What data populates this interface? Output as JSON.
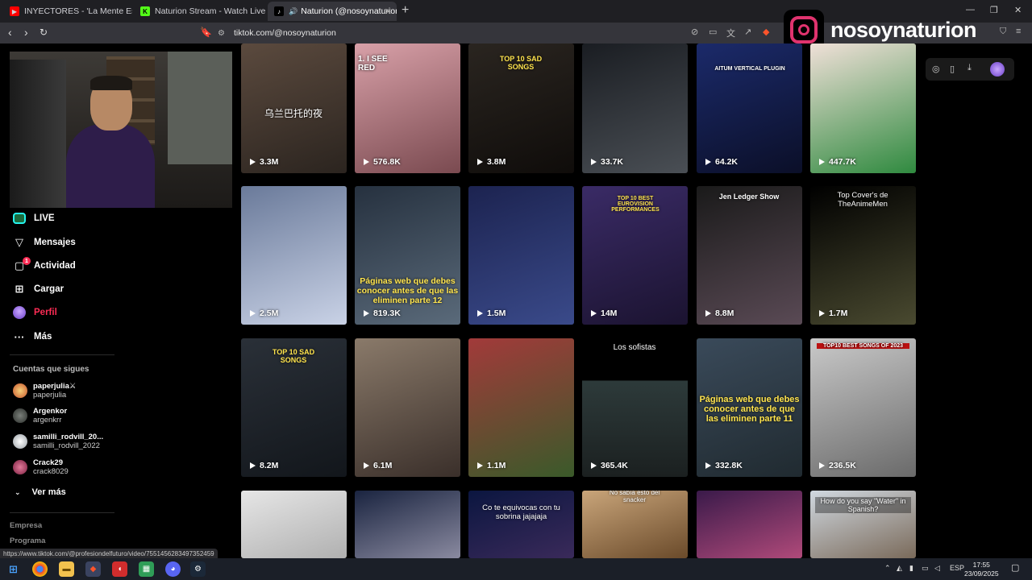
{
  "browser": {
    "tabs": [
      {
        "title": "INYECTORES - 'La Mente Es Un Lugar",
        "favicon": "youtube-icon",
        "color": "#ff0000"
      },
      {
        "title": "Naturion Stream - Watch Live on Kick",
        "favicon": "kick-icon",
        "color": "#53fc18"
      },
      {
        "title": "Naturion (@nosoynaturion) |",
        "favicon": "tiktok-icon",
        "color": "#ffffff",
        "active": true
      }
    ],
    "url": "tiktok.com/@nosoynaturion",
    "status_url": "https://www.tiktok.com/@profesiondelfuturo/video/7551456283497352459"
  },
  "overlay": {
    "instagram_handle": "nosoynaturion",
    "brand_color": "#e0336e"
  },
  "sidebar": {
    "items": [
      {
        "label": "LIVE",
        "icon": "live-icon"
      },
      {
        "label": "Mensajes",
        "icon": "send-icon"
      },
      {
        "label": "Actividad",
        "icon": "activity-icon",
        "badge": "1"
      },
      {
        "label": "Cargar",
        "icon": "upload-icon"
      },
      {
        "label": "Perfil",
        "icon": "profile-avatar"
      },
      {
        "label": "Más",
        "icon": "more-icon"
      }
    ],
    "following_heading": "Cuentas que sigues",
    "following": [
      {
        "name": "paperjulia⚔",
        "handle": "paperjulia"
      },
      {
        "name": "Argenkor",
        "handle": "argenkrr"
      },
      {
        "name": "samilli_rodvill_20...",
        "handle": "samilli_rodvill_2022"
      },
      {
        "name": "Crack29",
        "handle": "crack8029"
      }
    ],
    "see_more": "Ver más",
    "footer": [
      "Empresa",
      "Programa"
    ]
  },
  "videos": [
    {
      "views": "3.3M",
      "caption": "乌兰巴托的夜"
    },
    {
      "views": "576.8K",
      "caption": "1. I SEE RED"
    },
    {
      "views": "3.8M",
      "caption": "TOP 10 SAD SONGS"
    },
    {
      "views": "33.7K",
      "caption": ""
    },
    {
      "views": "64.2K",
      "caption": "AITUM VERTICAL PLUGIN"
    },
    {
      "views": "447.7K",
      "caption": ""
    },
    {
      "views": "2.5M",
      "caption": ""
    },
    {
      "views": "819.3K",
      "caption": "Páginas web que debes conocer antes de que las eliminen parte 12"
    },
    {
      "views": "1.5M",
      "caption": ""
    },
    {
      "views": "14M",
      "caption": "TOP 10 BEST EUROVISION PERFORMANCES"
    },
    {
      "views": "8.8M",
      "caption": "Jen Ledger Show"
    },
    {
      "views": "1.7M",
      "caption": "Top Cover's de TheAnimeMen"
    },
    {
      "views": "8.2M",
      "caption": "TOP 10 SAD SONGS"
    },
    {
      "views": "6.1M",
      "caption": ""
    },
    {
      "views": "1.1M",
      "caption": ""
    },
    {
      "views": "365.4K",
      "caption": "Los sofistas"
    },
    {
      "views": "332.8K",
      "caption": "Páginas web que debes conocer antes de que las eliminen parte 11"
    },
    {
      "views": "236.5K",
      "caption": "TOP10 BEST SONGS OF 2023"
    },
    {
      "views": "",
      "caption": ""
    },
    {
      "views": "",
      "caption": ""
    },
    {
      "views": "",
      "caption": "Co te equivocas con tu sobrina jajajaja"
    },
    {
      "views": "",
      "caption": "No sabía esto del snacker"
    },
    {
      "views": "",
      "caption": ""
    },
    {
      "views": "",
      "caption": "How do you say \"Water\" in Spanish?"
    }
  ],
  "taskbar": {
    "language": "ESP",
    "time": "17:55",
    "date": "23/09/2025"
  }
}
